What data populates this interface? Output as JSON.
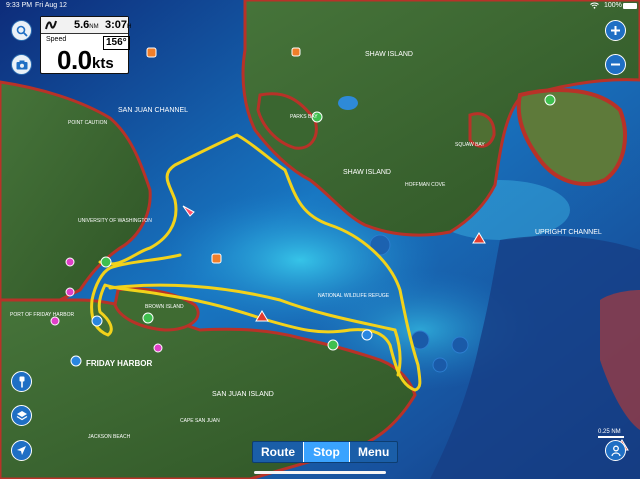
{
  "status_bar": {
    "time": "9:33 PM",
    "date": "Fri Aug 12",
    "battery_text": "100%"
  },
  "instrument": {
    "distance_value": "5.6",
    "distance_unit": "NM",
    "time_value": "3:07",
    "time_unit": "H",
    "speed_label": "Speed",
    "heading": "156°",
    "speed_value": "0.0",
    "speed_unit": "kts"
  },
  "map_labels": {
    "shaw_island_top": "SHAW ISLAND",
    "shaw_island_mid": "SHAW ISLAND",
    "san_juan_channel": "SAN JUAN CHANNEL",
    "upright_channel": "UPRIGHT CHANNEL",
    "friday_harbor": "FRIDAY HARBOR",
    "san_juan_island": "SAN JUAN ISLAND",
    "squaw_bay": "SQUAW BAY",
    "parks_bay": "PARKS BAY",
    "university": "UNIVERSITY OF WASHINGTON",
    "port_of_friday": "PORT OF FRIDAY HARBOR",
    "national_refuge": "NATIONAL WILDLIFE REFUGE",
    "point_caution": "POINT CAUTION",
    "hoffman_cove": "HOFFMAN COVE",
    "jackson_beach": "JACKSON BEACH",
    "cape_san_juan": "CAPE SAN JUAN",
    "brown_island": "BROWN ISLAND"
  },
  "toolbar": {
    "route_label": "Route",
    "stop_label": "Stop",
    "menu_label": "Menu"
  },
  "scale_label": "0.25 NM",
  "colors": {
    "track": "#f2d21b",
    "deep_water": "#0f3c8f",
    "shallow_water": "#2aa6d8",
    "land": "#3c6a2e",
    "shoreline": "#c0392b",
    "ui_blue": "#1f6fc4"
  }
}
